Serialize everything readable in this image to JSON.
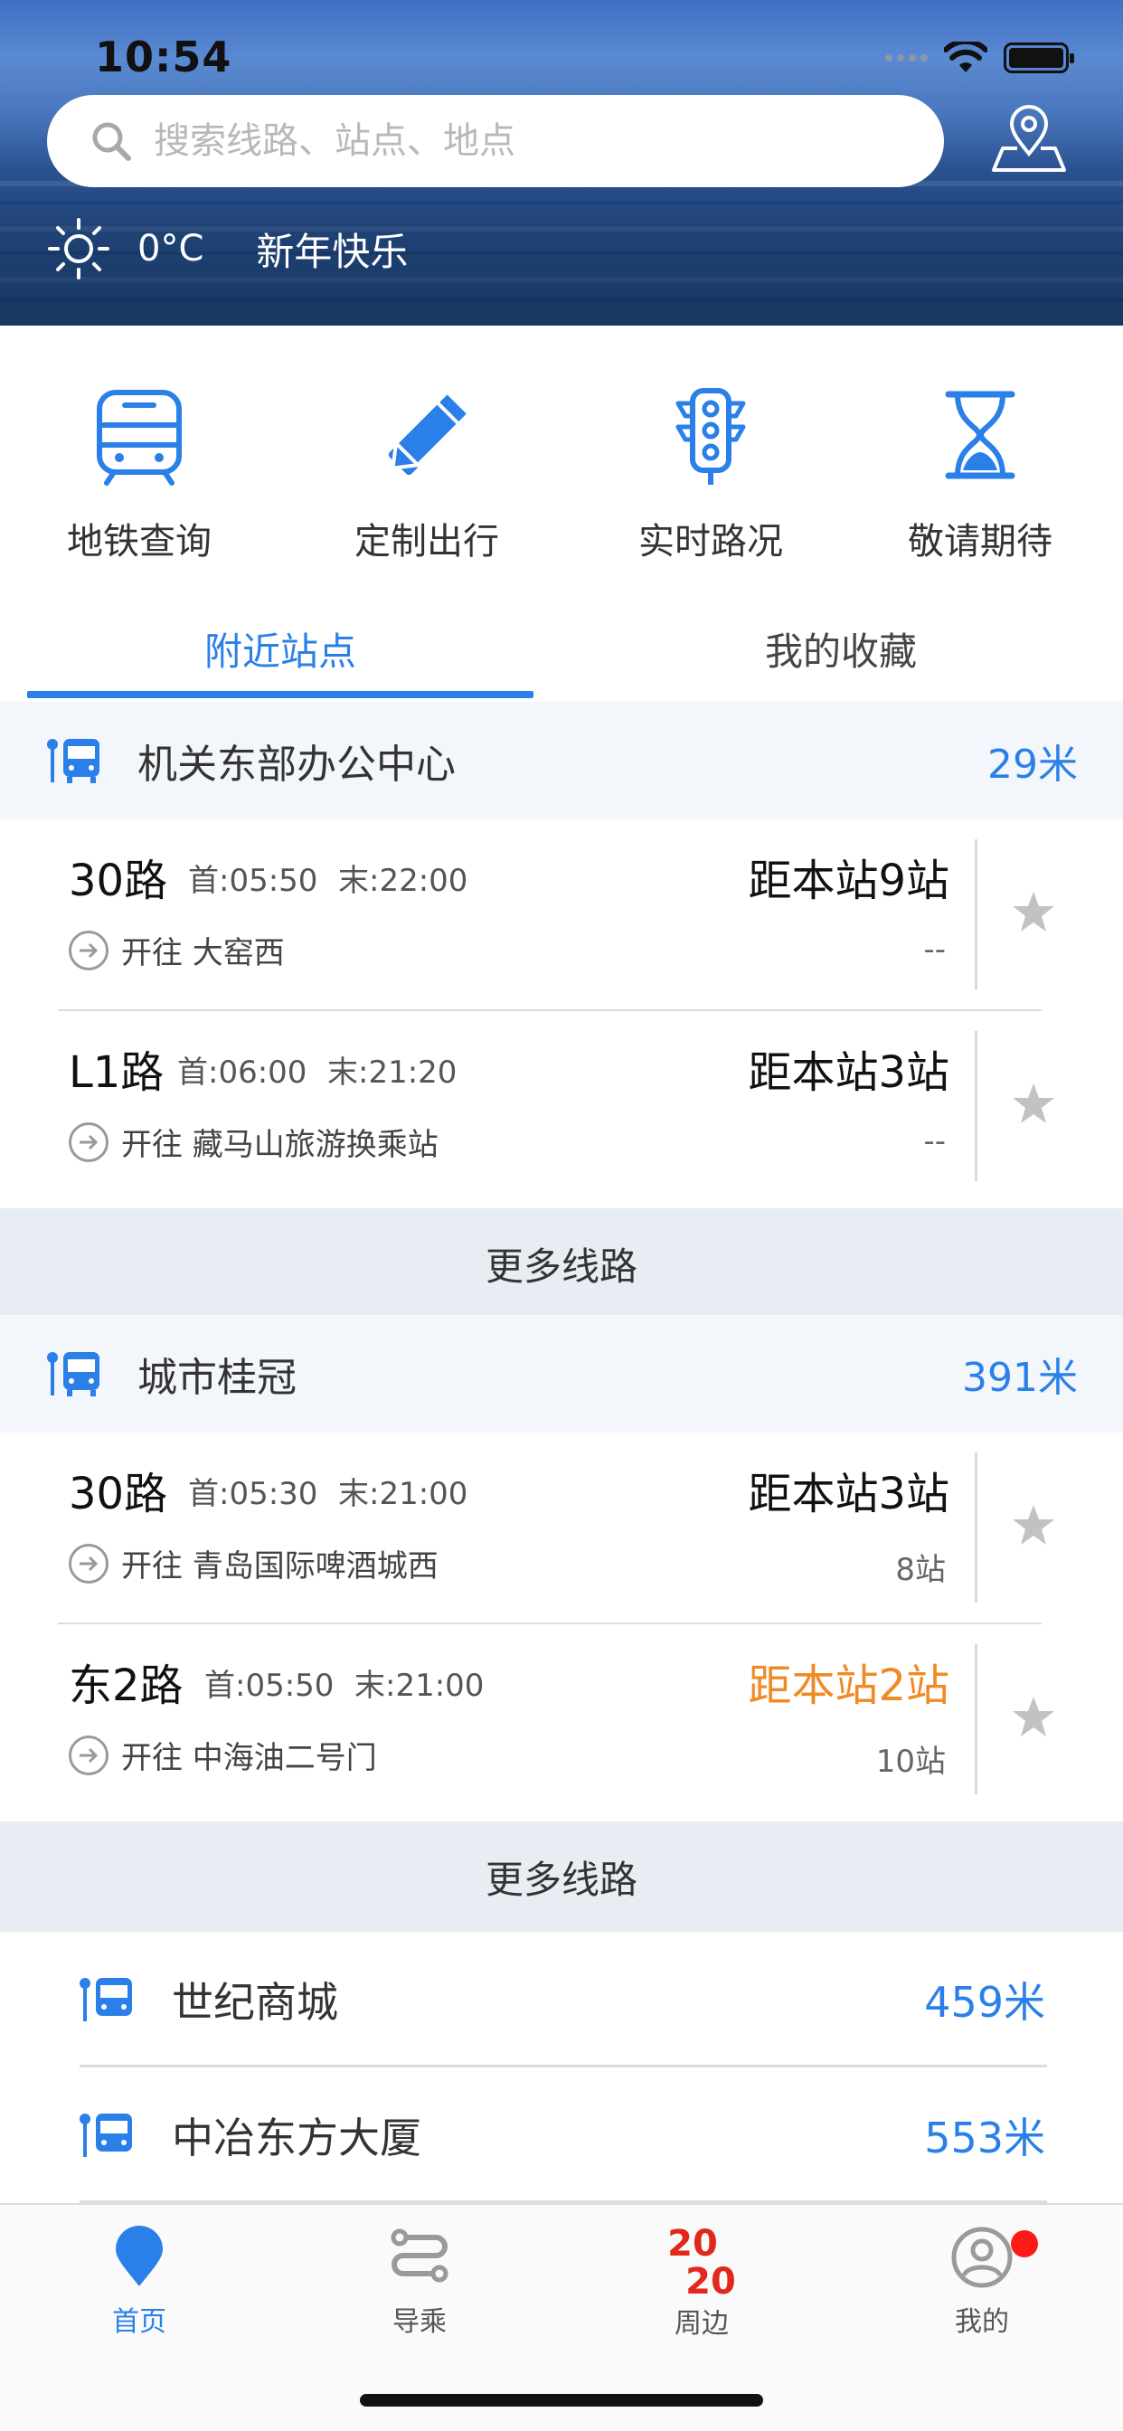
{
  "status_bar": {
    "time": "10:54"
  },
  "header": {
    "search_placeholder": "搜索线路、站点、地点",
    "weather_temp": "0°C",
    "greeting": "新年快乐"
  },
  "quick_actions": [
    {
      "label": "地铁查询",
      "icon": "subway-icon"
    },
    {
      "label": "定制出行",
      "icon": "pencil-ruler-icon"
    },
    {
      "label": "实时路况",
      "icon": "traffic-light-icon"
    },
    {
      "label": "敬请期待",
      "icon": "hourglass-icon"
    }
  ],
  "tabs": {
    "nearby": "附近站点",
    "favorites": "我的收藏"
  },
  "stations": [
    {
      "name": "机关东部办公中心",
      "distance": "29米",
      "routes": [
        {
          "name": "30路",
          "first": "首:05:50",
          "last": "末:22:00",
          "direction": "开往 大窑西",
          "status": "距本站9站",
          "stops": "--"
        },
        {
          "name": "L1路",
          "first": "首:06:00",
          "last": "末:21:20",
          "direction": "开往 藏马山旅游换乘站",
          "status": "距本站3站",
          "stops": "--"
        }
      ],
      "more_label": "更多线路"
    },
    {
      "name": "城市桂冠",
      "distance": "391米",
      "routes": [
        {
          "name": "30路",
          "first": "首:05:30",
          "last": "末:21:00",
          "direction": "开往 青岛国际啤酒城西",
          "status": "距本站3站",
          "stops": "8站"
        },
        {
          "name": "东2路",
          "first": "首:05:50",
          "last": "末:21:00",
          "direction": "开往 中海油二号门",
          "status": "距本站2站",
          "stops": "10站"
        }
      ],
      "more_label": "更多线路"
    }
  ],
  "nearby_list": [
    {
      "name": "世纪商城",
      "distance": "459米"
    },
    {
      "name": "中冶东方大厦",
      "distance": "553米"
    }
  ],
  "tab_bar": {
    "home": "首页",
    "guide": "导乘",
    "nearby": "周边",
    "mine": "我的",
    "logo_top": "20",
    "logo_bottom": "20"
  },
  "colors": {
    "accent": "#2a80e8",
    "orange": "#f08a24",
    "badge": "#ff1a1a"
  }
}
